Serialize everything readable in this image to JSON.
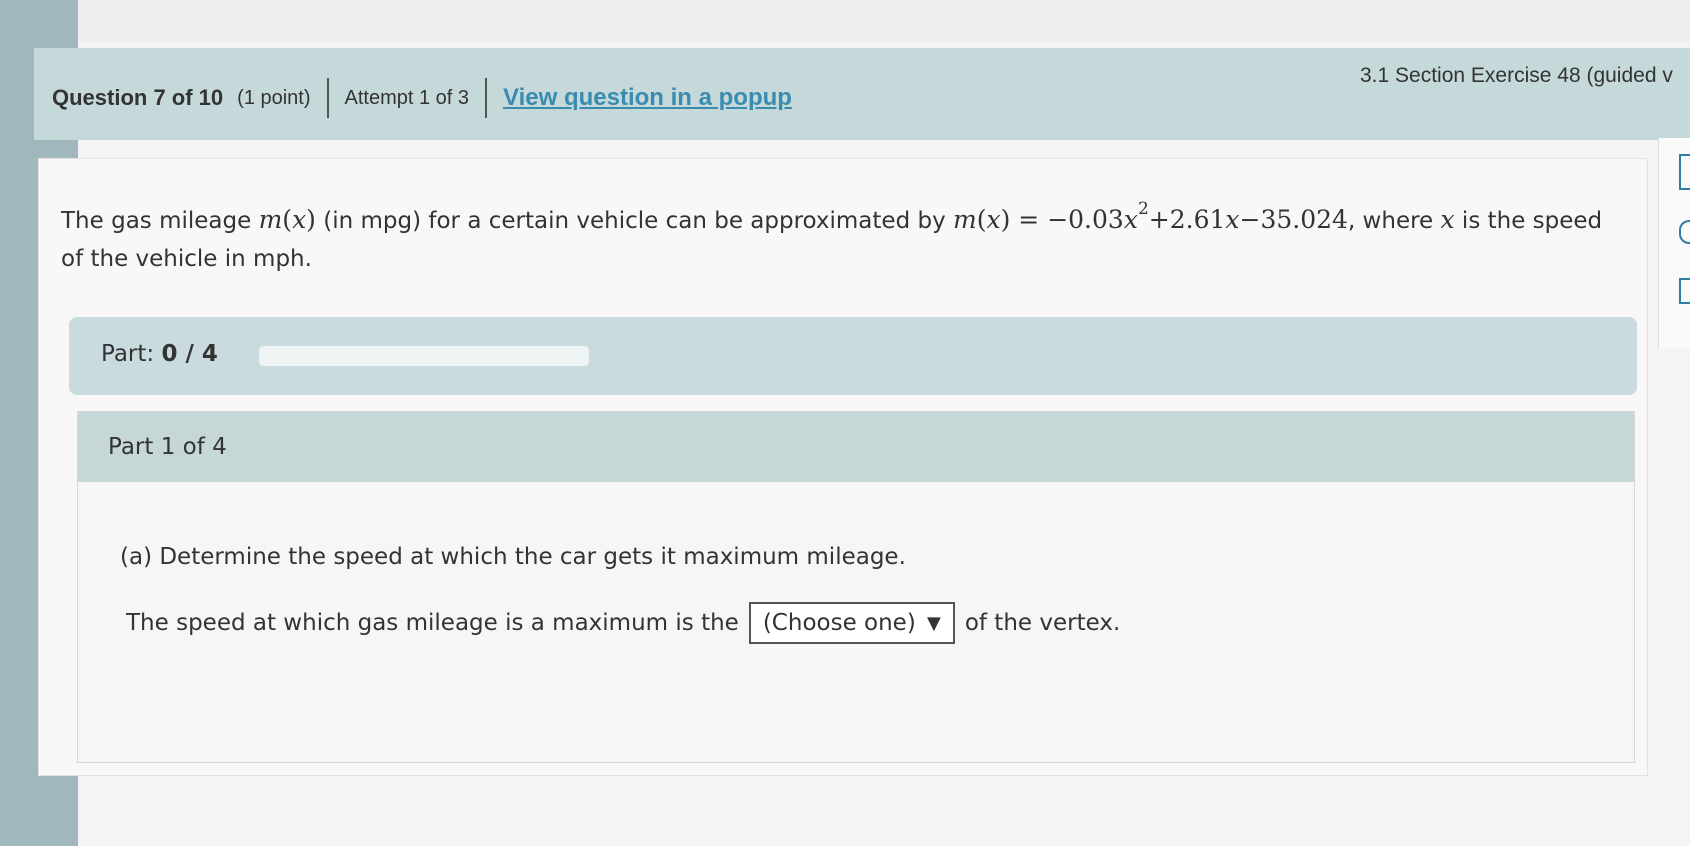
{
  "header": {
    "question_number": "Question 7 of 10",
    "points": "(1 point)",
    "attempt": "Attempt 1 of 3",
    "popup_link": "View question in a popup",
    "section_title": "3.1 Section Exercise 48 (guided v"
  },
  "problem": {
    "text_before": "The gas mileage ",
    "fn_name": "m",
    "fn_arg_open": "(",
    "fn_var": "x",
    "fn_arg_close": ")",
    "text_mid": " (in mpg) for a certain vehicle can be approximated by ",
    "eq_fn": "m",
    "eq_open": "(",
    "eq_var": "x",
    "eq_close": ")",
    "eq_sign": " = ",
    "term1_coef": "−0.03",
    "term1_var": "x",
    "term1_exp": "2",
    "term2": "+2.61",
    "term2_var": "x",
    "term3": "−35.024",
    "text_where": ", where ",
    "where_var": "x",
    "text_after": " is the speed of the vehicle in mph."
  },
  "progress": {
    "label": "Part:",
    "value": "0 / 4",
    "fraction": 0
  },
  "part": {
    "heading": "Part 1 of 4",
    "question": "(a) Determine the speed at which the car gets it maximum mileage.",
    "answer_prefix": "The speed at which gas mileage is a maximum is the",
    "dropdown_value": "(Choose one)",
    "dropdown_arrow": "▼",
    "answer_suffix": "of the vertex."
  },
  "colors": {
    "link": "#3a8bb0",
    "header_bg": "#c5d9da",
    "part_bar_bg": "#c9dbde"
  }
}
